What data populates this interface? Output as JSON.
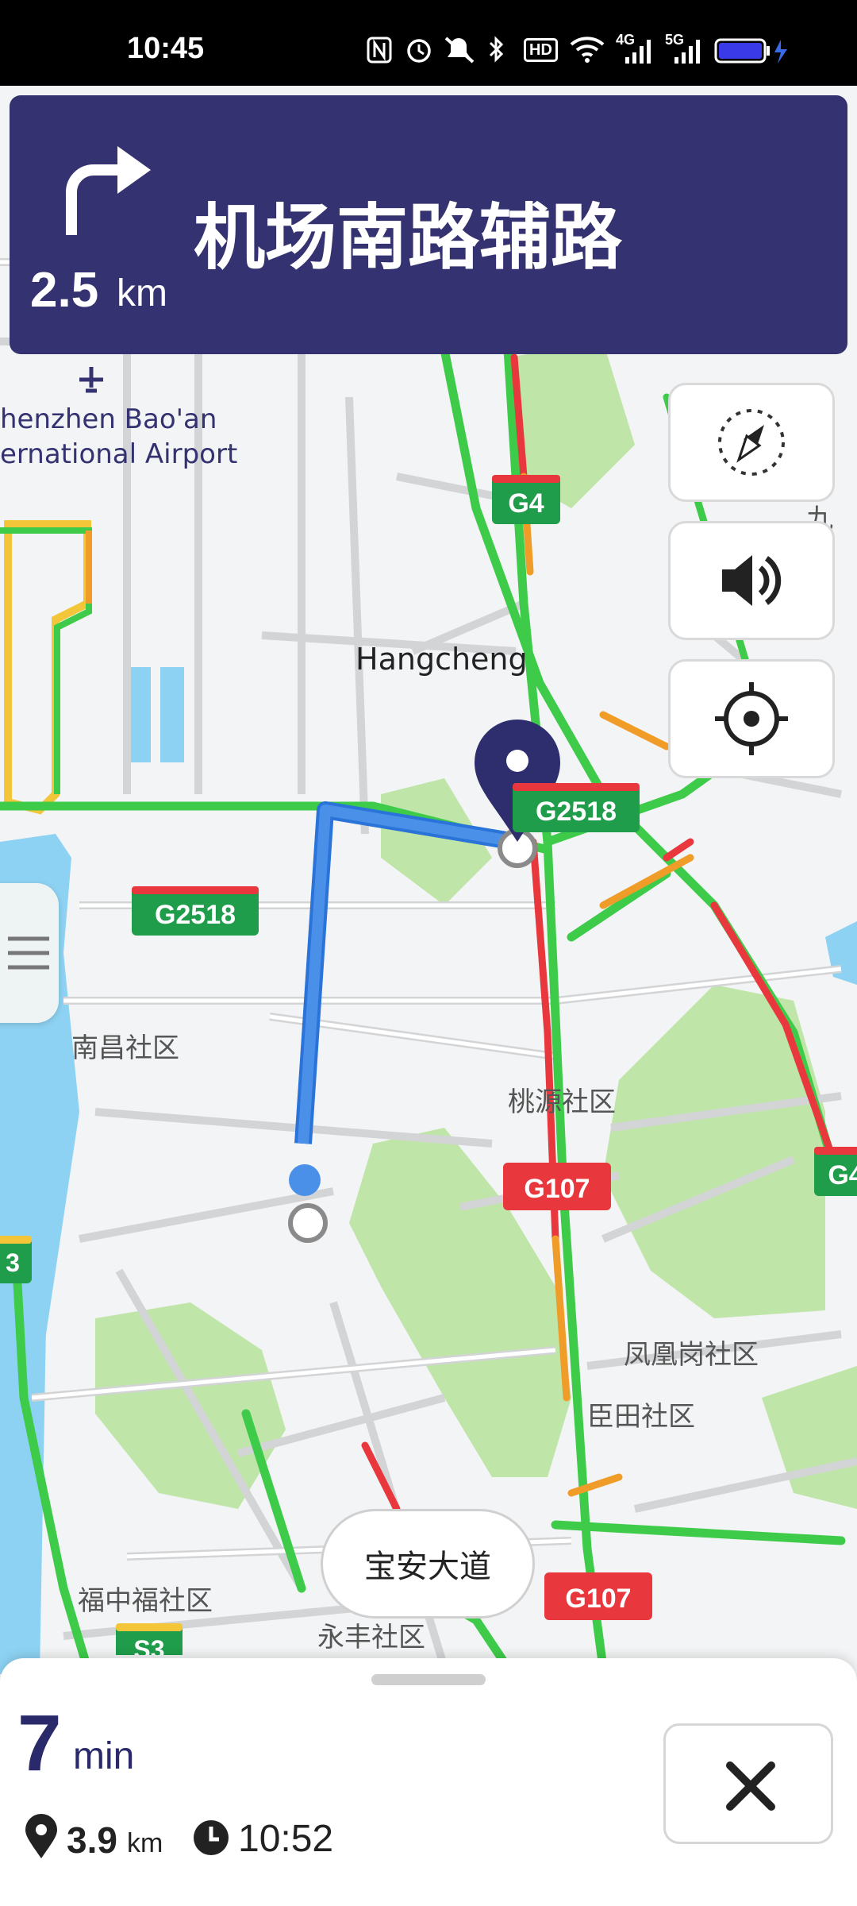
{
  "status_bar": {
    "time": "10:45",
    "icons": [
      "nfc-icon",
      "alarm-icon",
      "mute-icon",
      "bluetooth-icon",
      "hd-icon",
      "wifi-icon",
      "signal-4g-icon",
      "signal-5g-icon",
      "battery-icon"
    ],
    "hd_label": "HD",
    "net1": "4G",
    "net2": "5G"
  },
  "direction": {
    "maneuver_icon": "turn-right-icon",
    "street": "机场南路辅路",
    "distance": "2.5",
    "distance_unit": "km"
  },
  "map": {
    "places": {
      "airport_line1": "henzhen Bao'an",
      "airport_line2": "ernational Airport",
      "hangcheng": "Hangcheng",
      "nanchang": "南昌社区",
      "taoyuan": "桃源社区",
      "fenghuanggang": "凤凰岗社区",
      "chentian": "臣田社区",
      "fuzhongfu": "福中福社区",
      "yongfeng": "永丰社区",
      "jiuwei": "九围"
    },
    "shields": {
      "g4_top": "G4",
      "g2518_right": "G2518",
      "g2518_left": "G2518",
      "g107_mid": "G107",
      "g107_bottom": "G107",
      "g4_edge": "G4",
      "s3_edge": "3",
      "s3_bottom": "S3"
    },
    "street_chip": "宝安大道"
  },
  "controls": {
    "compass_icon": "compass-icon",
    "volume_icon": "volume-icon",
    "locate_icon": "locate-icon",
    "menu_icon": "menu-icon"
  },
  "trip": {
    "minutes": "7",
    "minutes_unit": "min",
    "distance": "3.9",
    "distance_unit": "km",
    "arrival": "10:52",
    "close_icon": "close-icon"
  },
  "colors": {
    "banner": "#343270",
    "route": "#4a90e8",
    "traffic_green": "#3ecb4a",
    "traffic_red": "#e8383d",
    "traffic_orange": "#f09c28",
    "park": "#bfe5a8",
    "water": "#8dd2f2"
  }
}
